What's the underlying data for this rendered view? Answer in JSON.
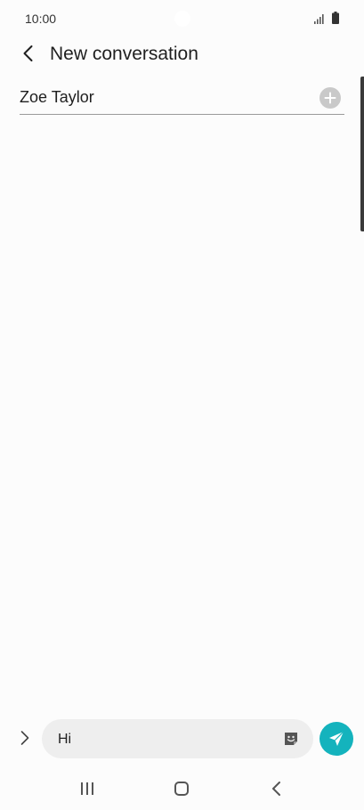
{
  "status_bar": {
    "time": "10:00",
    "icons": [
      "signal-icon",
      "battery-icon"
    ]
  },
  "header": {
    "title": "New conversation",
    "back_icon": "back-arrow-icon"
  },
  "recipient": {
    "value": "Zoe Taylor",
    "add_icon": "add-circle-icon"
  },
  "composer": {
    "expand_icon": "chevron-right-icon",
    "message_value": "Hi",
    "sticker_icon": "sticker-icon",
    "send_icon": "send-icon"
  },
  "navigation": {
    "recents_icon": "recents-icon",
    "home_icon": "home-icon",
    "back_icon": "back-icon"
  },
  "colors": {
    "background": "#fcfcfc",
    "accent": "#14b3bd",
    "input_background": "#eeeeee",
    "text": "#1f1f1f"
  }
}
